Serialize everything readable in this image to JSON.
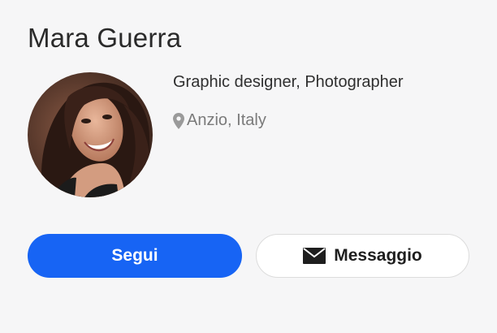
{
  "profile": {
    "name": "Mara Guerra",
    "headline": "Graphic designer, Photographer",
    "location": "Anzio, Italy"
  },
  "actions": {
    "follow_label": "Segui",
    "message_label": "Messaggio"
  },
  "colors": {
    "accent": "#1764f4",
    "card_background": "#f6f6f7"
  },
  "icons": {
    "location": "map-pin-icon",
    "message": "envelope-icon"
  }
}
